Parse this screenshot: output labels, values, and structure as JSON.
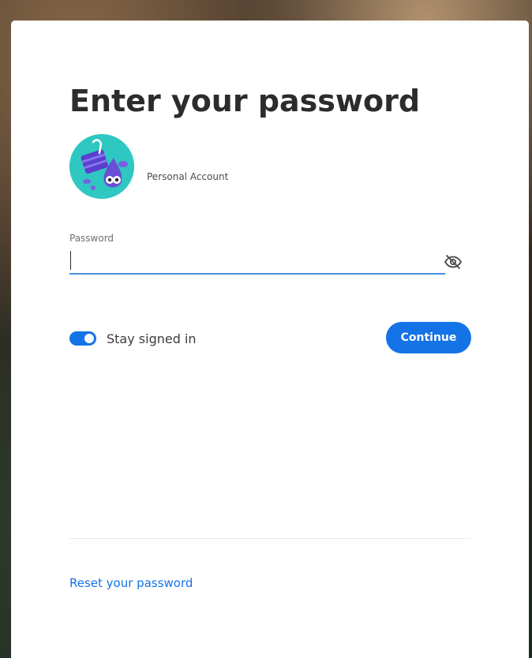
{
  "colors": {
    "accent": "#1473e6",
    "input_underline": "#4a8fd9",
    "title_text": "#2c2c2c",
    "avatar_bg": "#2fc7c1",
    "avatar_figure": "#6a4fd6"
  },
  "page": {
    "title": "Enter your password"
  },
  "account": {
    "avatar_icon": "cartoon-character-avatar-icon",
    "label": "Personal Account"
  },
  "password_field": {
    "label": "Password",
    "value": "",
    "placeholder": "",
    "visibility_icon": "eye-slash-icon"
  },
  "stay_signed_in": {
    "label": "Stay signed in",
    "enabled": true
  },
  "actions": {
    "continue_label": "Continue"
  },
  "footer": {
    "reset_link_label": "Reset your password"
  }
}
